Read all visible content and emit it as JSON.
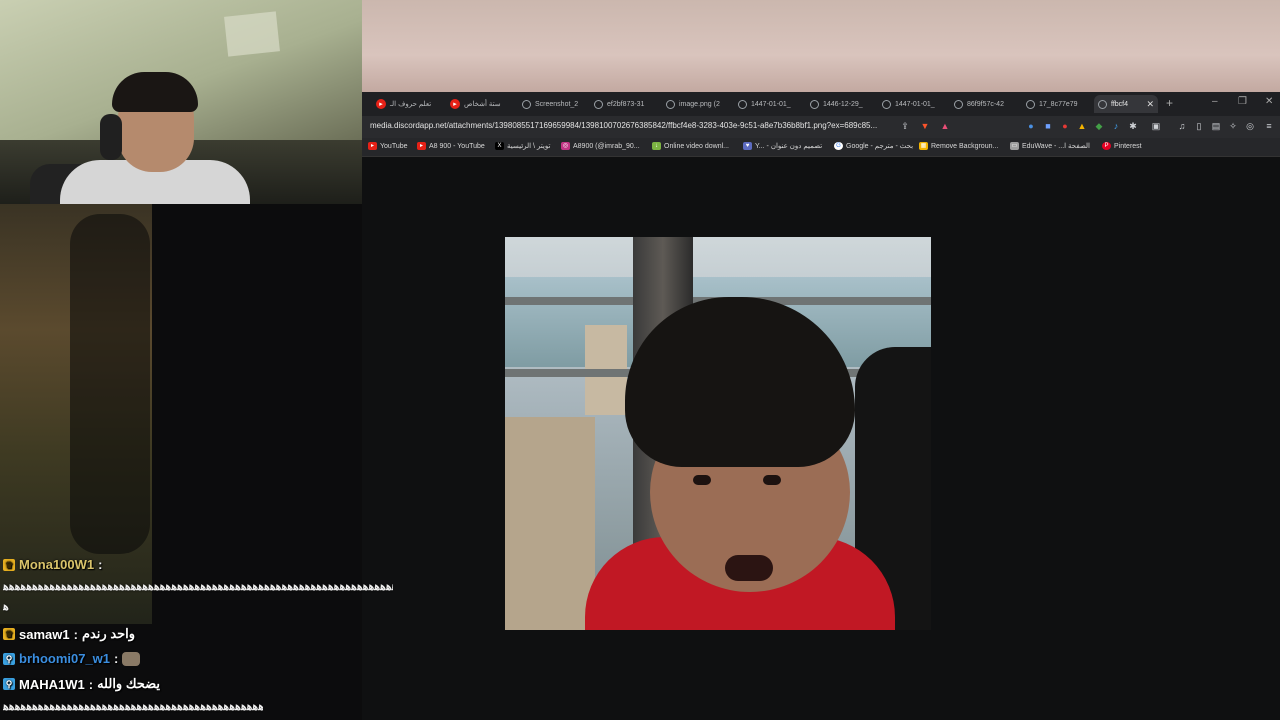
{
  "browser": {
    "tabs": [
      {
        "title": "تعلم حروف الـ",
        "favicon": "youtube-icon",
        "active": false
      },
      {
        "title": "ستة أشخاص",
        "favicon": "youtube-icon",
        "active": false
      },
      {
        "title": "Screenshot_2",
        "favicon": "globe-icon",
        "active": false
      },
      {
        "title": "ef2bf873-31",
        "favicon": "globe-icon",
        "active": false
      },
      {
        "title": "image.png (2",
        "favicon": "globe-icon",
        "active": false
      },
      {
        "title": "1447-01-01_",
        "favicon": "globe-icon",
        "active": false
      },
      {
        "title": "1446-12-29_",
        "favicon": "globe-icon",
        "active": false
      },
      {
        "title": "1447-01-01_",
        "favicon": "globe-icon",
        "active": false
      },
      {
        "title": "86f9f57c-42",
        "favicon": "globe-icon",
        "active": false
      },
      {
        "title": "17_8c77e79",
        "favicon": "globe-icon",
        "active": false
      },
      {
        "title": "ffbcf4",
        "favicon": "globe-icon",
        "active": true
      }
    ],
    "new_tab": "+",
    "window_controls": {
      "minimize": "–",
      "restore": "❐",
      "close": "✕"
    },
    "url": "media.discordapp.net/attachments/1398085517169659984/1398100702676385842/ffbcf4e8-3283-403e-9c51-a8e7b36b8bf1.png?ex=689c85...",
    "bookmarks": [
      {
        "label": "YouTube",
        "icon": "youtube-icon",
        "color": "#e62117"
      },
      {
        "label": "A8 900 - YouTube",
        "icon": "youtube-icon",
        "color": "#e62117"
      },
      {
        "label": "تويتر \\ الرئيسية",
        "icon": "x-icon",
        "color": "#000000"
      },
      {
        "label": "A8900 (@imrab_90...",
        "icon": "instagram-icon",
        "color": "#c13584"
      },
      {
        "label": "Online video downl...",
        "icon": "download-icon",
        "color": "#7cb342"
      },
      {
        "label": "Y... - تصميم دون عنوان",
        "icon": "heart-icon",
        "color": "#5c6bc0"
      },
      {
        "label": "Google - بحث - مترجم",
        "icon": "google-icon",
        "color": "#4285f4"
      },
      {
        "label": "Remove Backgroun...",
        "icon": "image-icon",
        "color": "#f4b400"
      },
      {
        "label": "EduWave - ...الصفحة ا",
        "icon": "page-icon",
        "color": "#9e9e9e"
      },
      {
        "label": "Pinterest",
        "icon": "pinterest-icon",
        "color": "#e60023"
      }
    ]
  },
  "chat": {
    "messages": [
      {
        "user": "Mona100W1",
        "badge": "crown-icon",
        "user_color": "#d9c36a",
        "text": "",
        "continuation": "ﻫﻫﻫﻫﻫﻫﻫﻫﻫﻫﻫﻫﻫﻫﻫﻫﻫﻫﻫﻫﻫﻫﻫﻫﻫﻫﻫﻫﻫﻫﻫﻫﻫﻫﻫﻫﻫﻫﻫﻫﻫﻫﻫﻫﻫﻫﻫﻫﻫﻫﻫﻫﻫﻫﻫﻫﻫﻫﻫﻫﻫﻫﻫﻫﻫﻫﻫﻫﻫﻫﻫﻫﻫﻫﻫﻫ",
        "continuation2": "ﻫ"
      },
      {
        "user": "samaw1",
        "badge": "crown-icon",
        "user_color": "#ffffff",
        "text": "واحد رندم"
      },
      {
        "user": "brhoomi07_w1",
        "badge": "pin-icon",
        "user_color": "#3b8ee0",
        "text": "",
        "emote": "emote-icon"
      },
      {
        "user": "MAHA1W1",
        "badge": "pin-icon",
        "user_color": "#ffffff",
        "text": "يضحك والله",
        "continuation": "ﻫﻫﻫﻫﻫﻫﻫﻫﻫﻫﻫﻫﻫﻫﻫﻫﻫﻫﻫﻫﻫﻫﻫﻫﻫﻫﻫﻫﻫﻫﻫﻫﻫﻫﻫﻫﻫﻫﻫﻫﻫﻫﻫﻫﻫﻫﻫ"
      }
    ],
    "separator": ":"
  }
}
